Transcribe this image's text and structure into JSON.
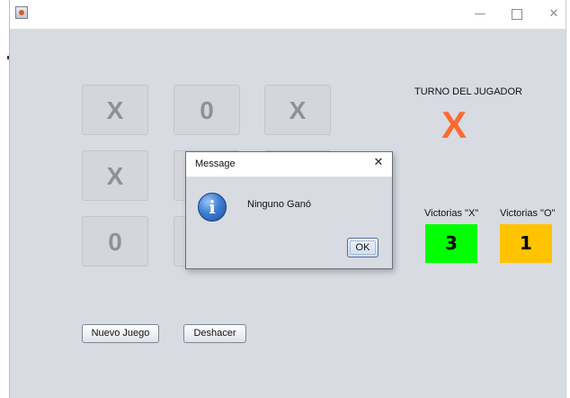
{
  "window": {
    "title_icon": "java-app-icon",
    "controls": {
      "minimize": "—",
      "maximize": "maximize-icon",
      "close": "✕"
    }
  },
  "board": {
    "cells": [
      "X",
      "0",
      "X",
      "X",
      "",
      "",
      "0",
      "",
      ""
    ]
  },
  "turn": {
    "label": "TURNO DEL JUGADOR",
    "player": "X",
    "color": "#ff6a33"
  },
  "scoreboard": {
    "x_label": "Victorias \"X\"",
    "o_label": "Victorias \"O\"",
    "x_wins": "3",
    "o_wins": "1",
    "x_color": "#00ff00",
    "o_color": "#ffc300"
  },
  "buttons": {
    "new_game": "Nuevo Juego",
    "undo": "Deshacer"
  },
  "dialog": {
    "title": "Message",
    "close": "✕",
    "icon": "info-icon",
    "icon_glyph": "i",
    "message": "Ninguno Ganó",
    "ok": "OK"
  }
}
